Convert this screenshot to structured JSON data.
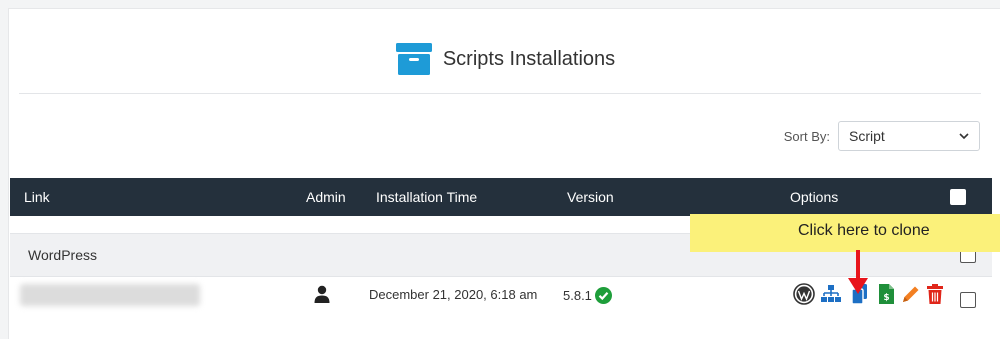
{
  "page": {
    "title": "Scripts Installations"
  },
  "sort": {
    "label": "Sort By:",
    "selected": "Script"
  },
  "table": {
    "headers": {
      "link": "Link",
      "admin": "Admin",
      "time": "Installation Time",
      "version": "Version",
      "options": "Options"
    },
    "groups": [
      {
        "name": "WordPress",
        "rows": [
          {
            "time": "December 21, 2020, 6:18 am",
            "version": "5.8.1",
            "version_status": "up-to-date"
          }
        ]
      }
    ]
  },
  "option_icons": [
    "wordpress-icon",
    "sitemap-icon",
    "clone-icon",
    "backup-icon",
    "edit-icon",
    "trash-icon"
  ],
  "tooltip": {
    "text": "Click here to clone"
  },
  "colors": {
    "header_bg": "#24303c",
    "title_icon": "#1e9bd7",
    "tooltip_bg": "#fbf17a",
    "arrow": "#e8141b",
    "ok_green": "#1e9e3a",
    "blue_icon": "#1d6fc4",
    "green_icon": "#1f8f3a",
    "orange_icon": "#f37f21",
    "red_icon": "#e0261a"
  }
}
